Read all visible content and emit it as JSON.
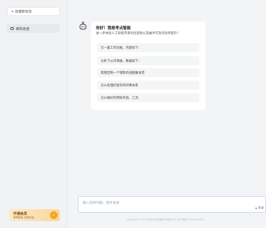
{
  "sidebar": {
    "new_chat_label": "+ 创建新会话",
    "chat_items": [
      {
        "label": "新的会话"
      }
    ],
    "member": {
      "title": "开通会员",
      "subtitle": "尊享服务 无限对话"
    }
  },
  "welcome": {
    "title": "你好！我是考点智能",
    "subtitle": "进一步体验人工智能带来的创造性以及触手可及的效率提升！",
    "prompts": [
      {
        "text": "写一篇工作日报，内容如下："
      },
      {
        "text": "分析下公司简报，数据如下："
      },
      {
        "text": "帮我定制一个销售的减肥餐食谱"
      },
      {
        "text": "怎么处理好复杂的同事关系"
      },
      {
        "text": "怎么做好的预防开放。乙流"
      }
    ]
  },
  "input": {
    "placeholder": "输入您的问题，回车发送",
    "send_label": "发送"
  },
  "footer": {
    "text": "Copyright © 2023 北京考点智能科技有限公司  京ICP备2023000000号-1"
  }
}
